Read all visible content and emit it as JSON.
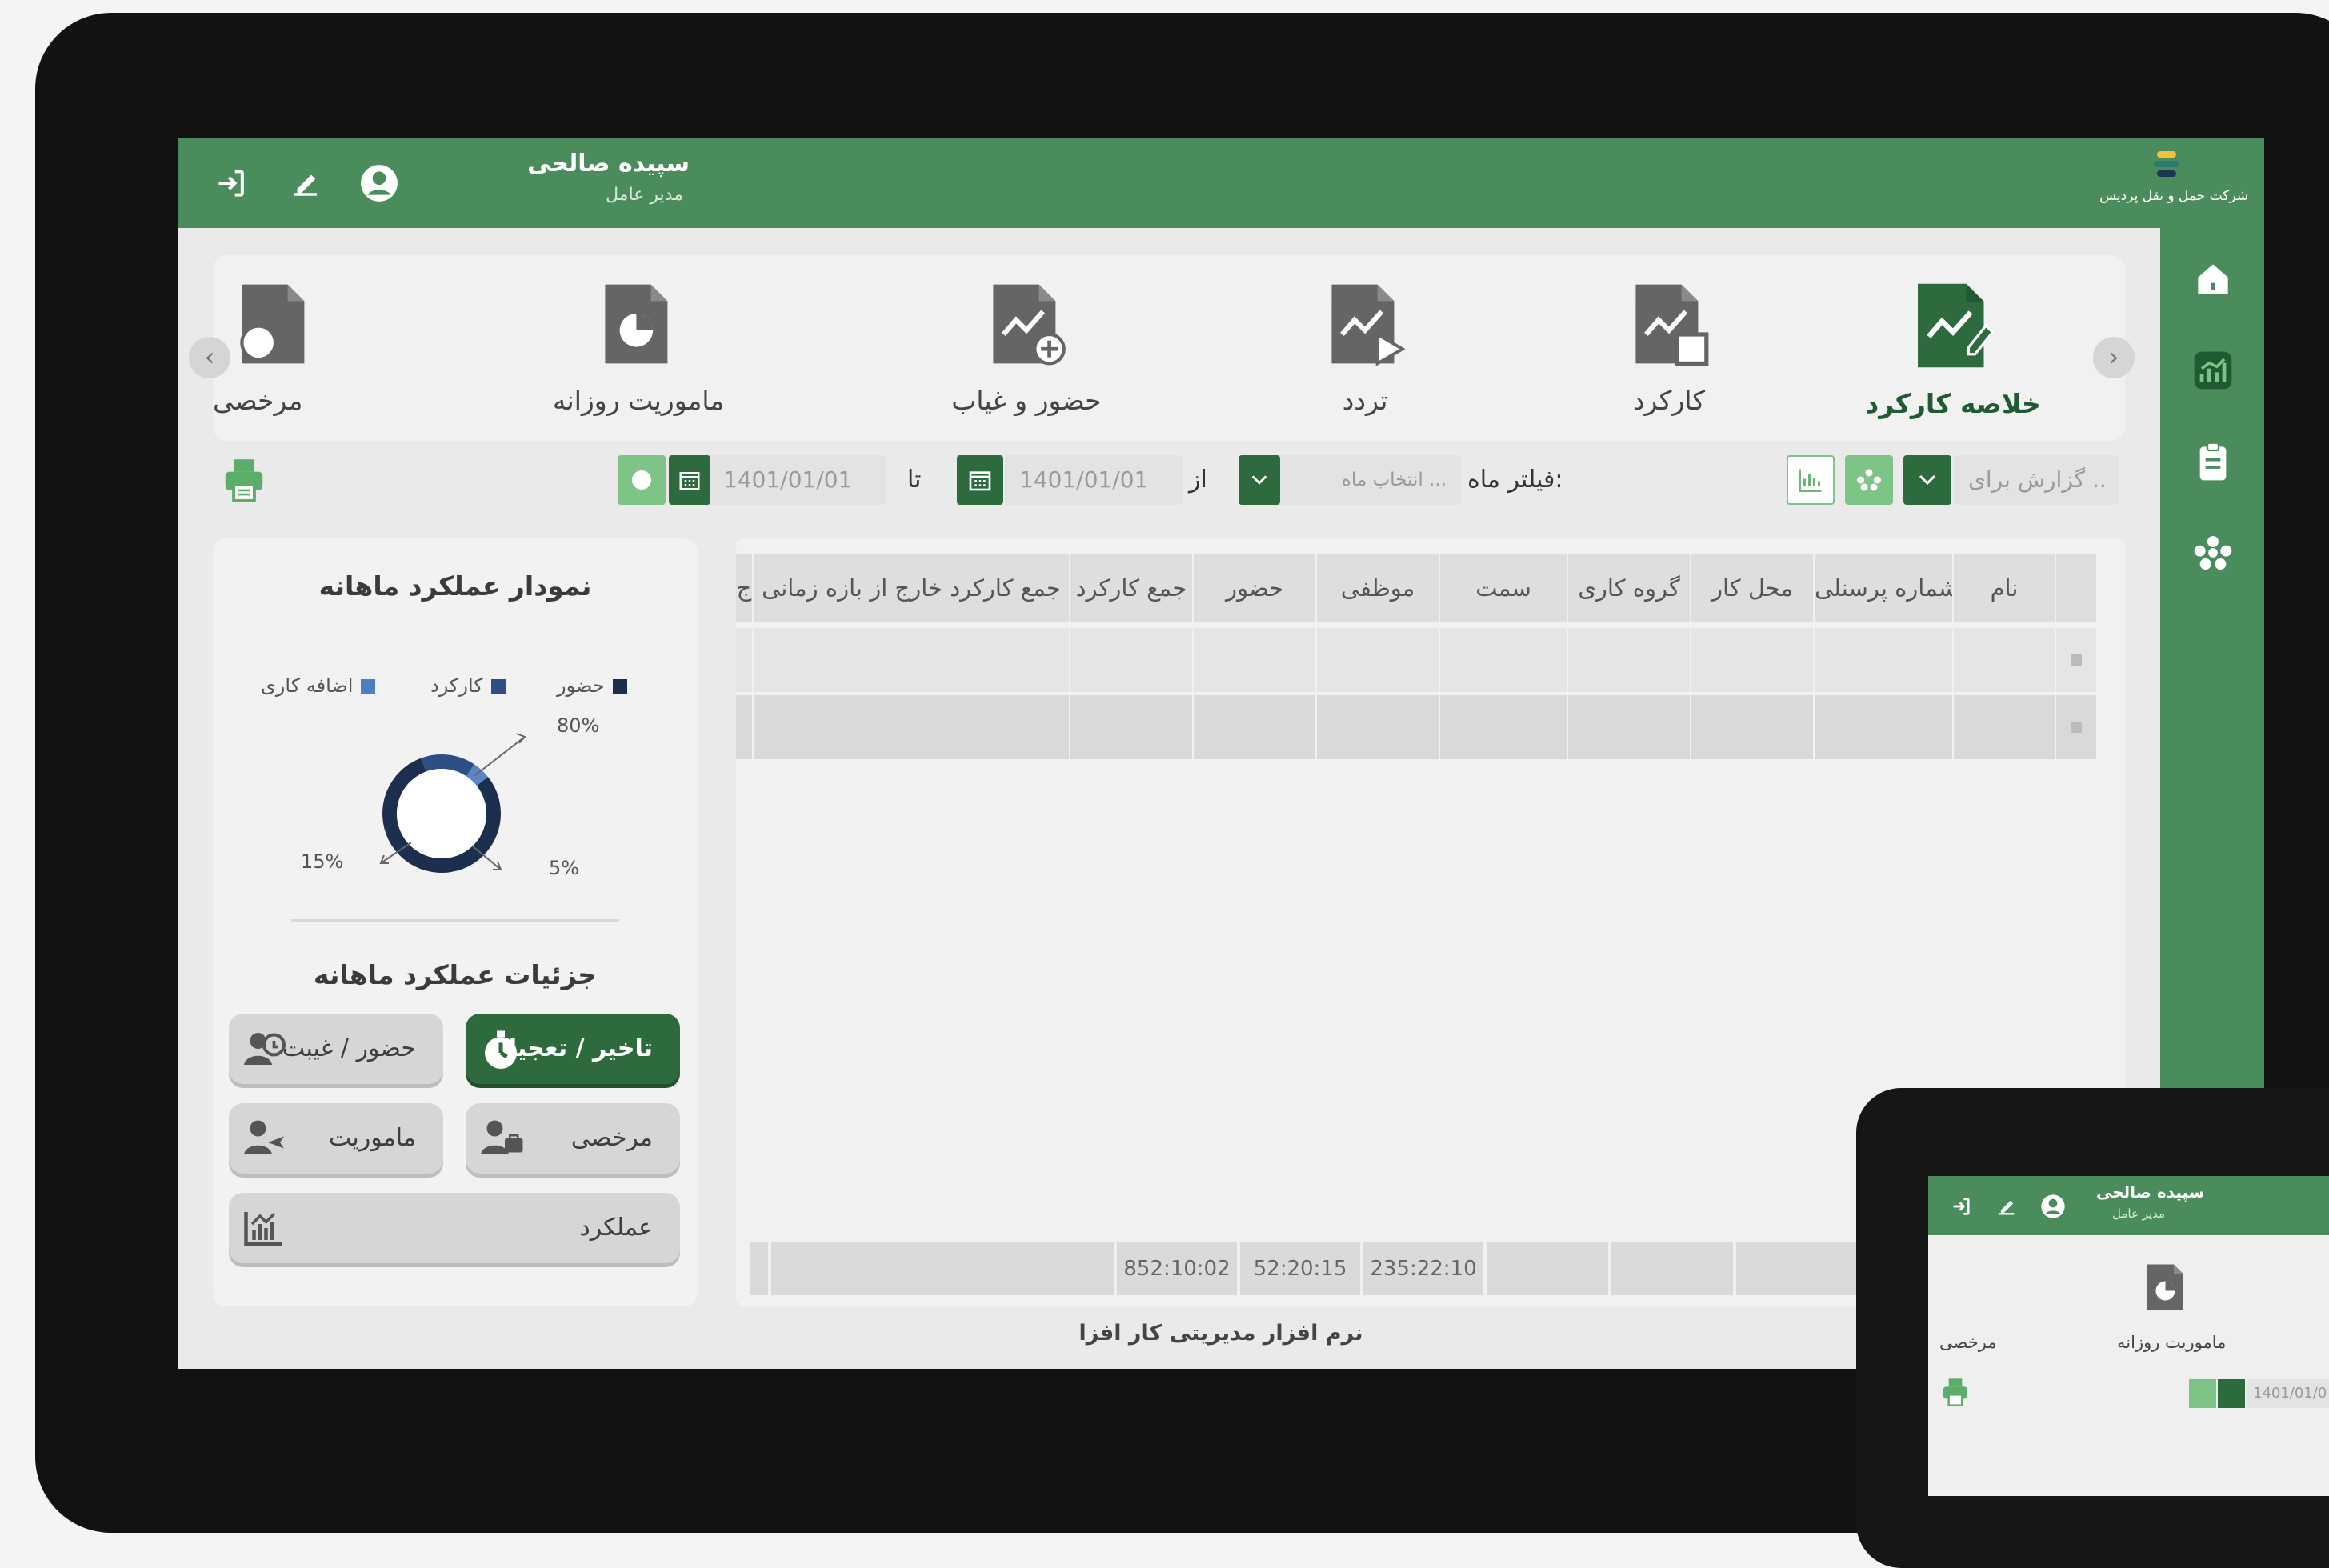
{
  "header": {
    "user_name": "سپیده صالحی",
    "user_role": "مدیر عامل",
    "company_name": "شرکت حمل و نقل پردیس"
  },
  "nav": {
    "items": [
      {
        "label": "خلاصه کارکرد",
        "icon": "performance-summary-icon",
        "active": true
      },
      {
        "label": "کارکرد",
        "icon": "work-report-icon"
      },
      {
        "label": "تردد",
        "icon": "traffic-report-icon"
      },
      {
        "label": "حضور و غیاب",
        "icon": "attendance-report-icon"
      },
      {
        "label": "ماموریت روزانه",
        "icon": "daily-mission-icon"
      },
      {
        "label": "مرخصی",
        "icon": "leave-icon"
      }
    ]
  },
  "filters": {
    "report_for_placeholder": "گزارش برای ..",
    "month_filter_label": "فیلتر ماه:",
    "month_placeholder": "انتخاب ماه ...",
    "from_label": "از",
    "from_date": "1401/01/01",
    "to_label": "تا",
    "to_date": "1401/01/01"
  },
  "chart_panel": {
    "title": "نمودار عملکرد ماهانه",
    "details_title": "جزئیات عملکرد ماهانه"
  },
  "chart_data": {
    "type": "pie",
    "title": "نمودار عملکرد ماهانه",
    "legend": [
      "حضور",
      "کارکرد",
      "اضافه کاری"
    ],
    "values": [
      80,
      15,
      5
    ],
    "labels": [
      "80%",
      "15%",
      "5%"
    ],
    "colors": [
      "#1d2f4f",
      "#2d4f86",
      "#5b84c4"
    ],
    "legend_colors": [
      "#1d2f4f",
      "#2d4f86",
      "#4b7fc1"
    ]
  },
  "detail_buttons": {
    "delay": "تاخیر / تعجیل",
    "attendance": "حضور / غیبت",
    "leave": "مرخصی",
    "mission": "ماموریت",
    "performance": "عملکرد"
  },
  "table": {
    "columns": [
      "نام",
      "شماره پرسنلی",
      "محل کار",
      "گروه کاری",
      "سمت",
      "موظفی",
      "حضور",
      "جمع کارکرد",
      "جمع کارکرد خارج از بازه زمانی",
      "ج"
    ],
    "footer": {
      "mandatory": "235:22:10",
      "presence": "52:20:15",
      "total": "852:10:02"
    }
  },
  "footer": {
    "text": "نرم افزار مدیریتی کار افزا"
  },
  "tablet": {
    "user_name": "سپیده صالحی",
    "user_role": "مدیر عامل",
    "nav_daily_mission": "ماموریت روزانه",
    "nav_leave": "مرخصی",
    "date": "1401/01/0"
  },
  "colors": {
    "primary": "#4a8c5c",
    "primary_dark": "#2d6b3e",
    "accent_light": "#7fc487"
  }
}
